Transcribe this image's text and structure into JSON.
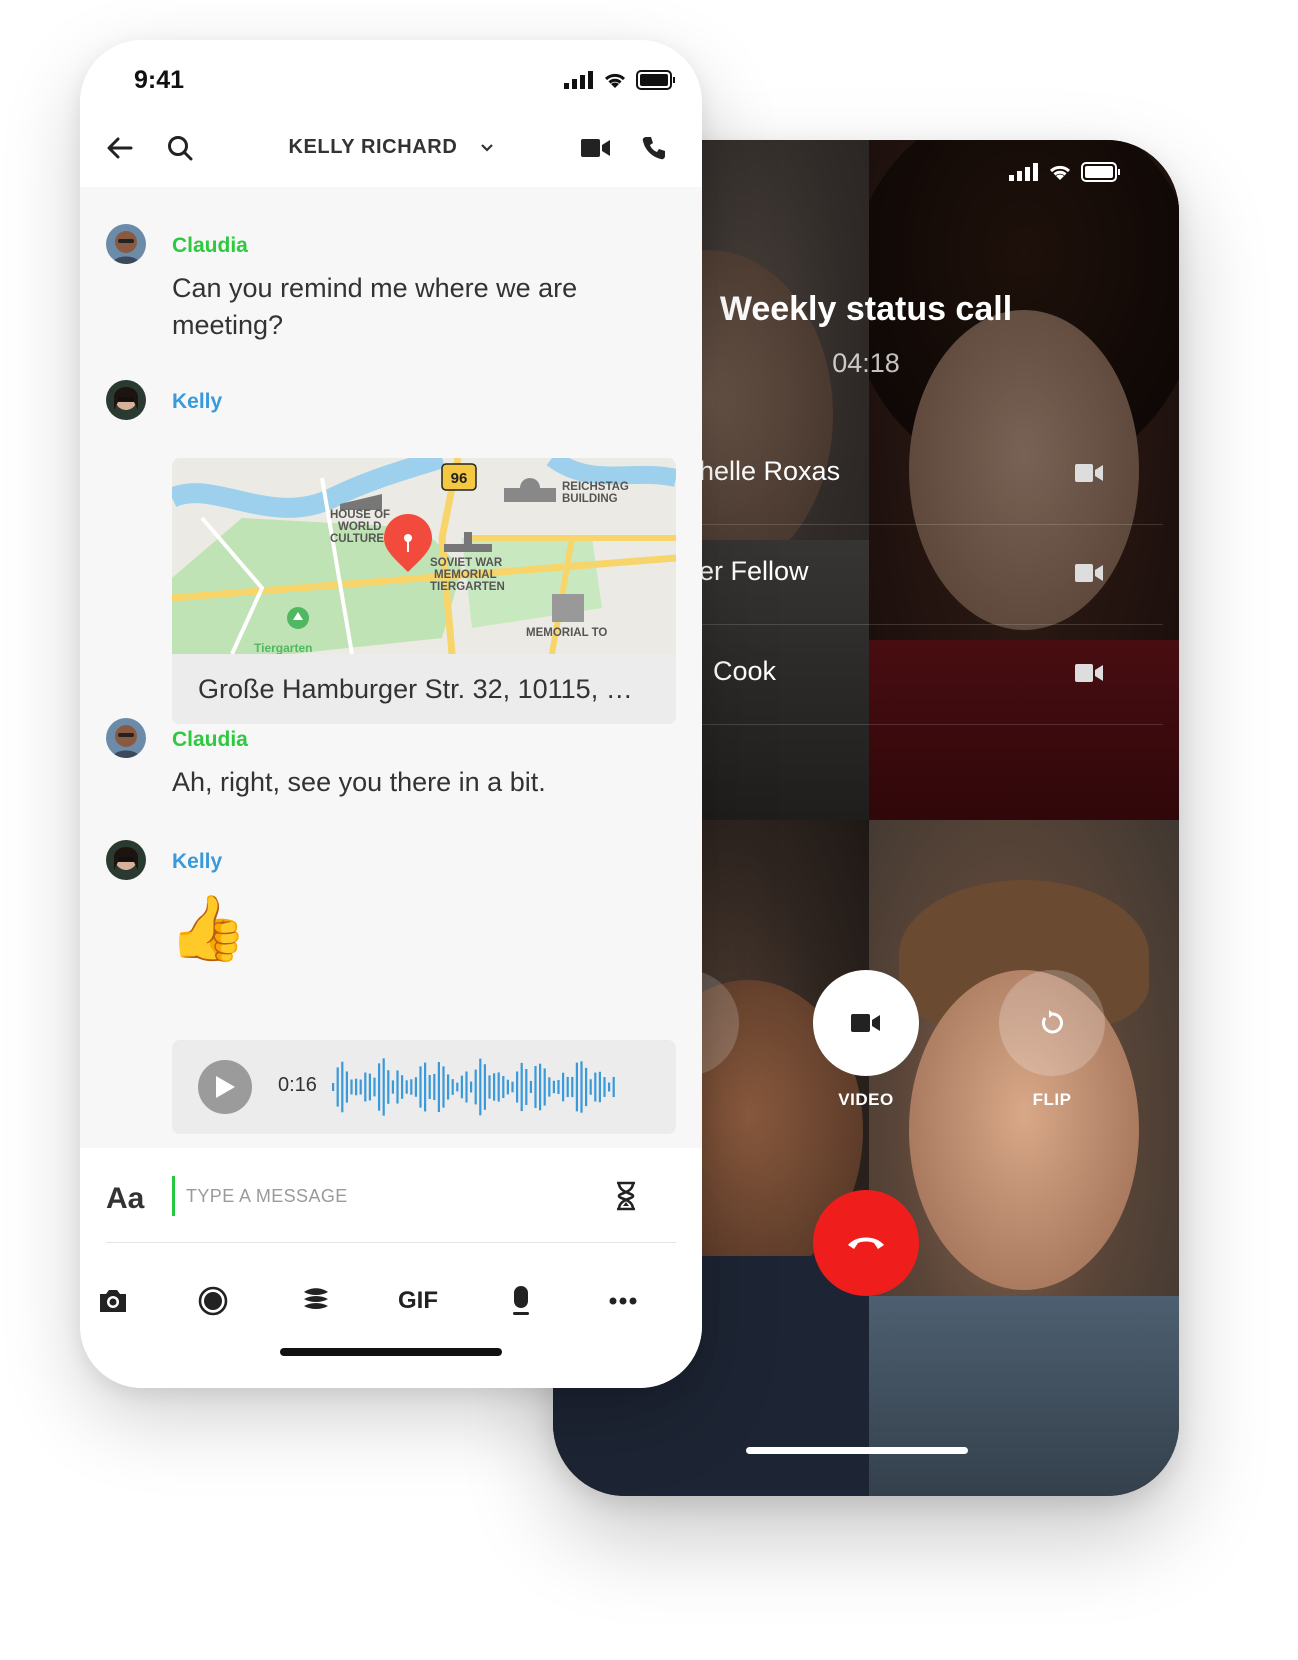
{
  "call": {
    "title": "Weekly status call",
    "timer": "04:18",
    "participants": [
      {
        "name": "helle Roxas"
      },
      {
        "name": "er Fellow"
      },
      {
        "name": "Cook"
      }
    ],
    "controls": {
      "video_label": "VIDEO",
      "flip_label": "FLIP"
    },
    "colors": {
      "end_call": "#f01d1d"
    }
  },
  "chat": {
    "status_time": "9:41",
    "contact_name": "KELLY RICHARD",
    "messages": [
      {
        "sender": "Claudia",
        "text": "Can you remind me where we are meeting?"
      },
      {
        "sender": "Kelly",
        "map": {
          "labels": {
            "road_sign": "96",
            "house": "HOUSE OF\nWORLD\nCULTURE",
            "reichstag": "REICHSTAG\nBUILDING",
            "memorial": "SOVIET WAR\nMEMORIAL\nTIERGARTEN",
            "memorial2": "MEMORIAL TO",
            "park": "Tiergarten"
          },
          "address": "Große Hamburger Str. 32, 10115, …"
        }
      },
      {
        "sender": "Claudia",
        "text": "Ah, right, see you there in a bit."
      },
      {
        "sender": "Kelly",
        "emoji": "👍",
        "audio": {
          "duration": "0:16"
        }
      }
    ],
    "compose": {
      "format_label": "Aa",
      "placeholder": "TYPE A MESSAGE"
    },
    "toolbar": {
      "gif_label": "GIF"
    },
    "colors": {
      "claudia": "#2ec940",
      "kelly": "#3a9ad9",
      "waveform": "#3a9ad9"
    }
  }
}
